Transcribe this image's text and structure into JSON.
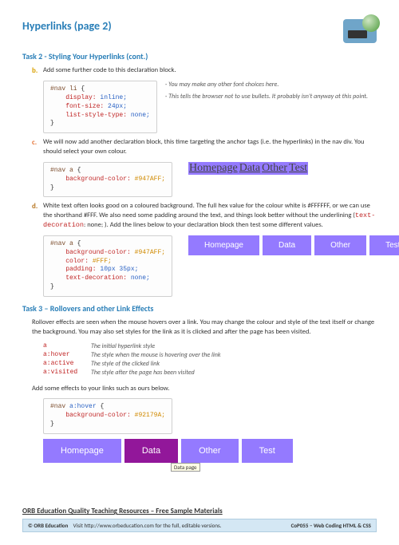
{
  "header": {
    "title": "Hyperlinks (page 2)"
  },
  "task2": {
    "heading": "Task 2 - Styling Your Hyperlinks (cont.)",
    "b": {
      "marker": "b.",
      "text": "Add some further code to this declaration block.",
      "code": {
        "sel": "#nav li",
        "l1p": "display:",
        "l1v": "inline;",
        "l2p": "font-size:",
        "l2v": "24px;",
        "l3p": "list-style-type:",
        "l3v": "none;"
      },
      "note1": "You may make any other font choices here.",
      "note2": "This tells the browser not to use bullets.  It probably isn't anyway at this point."
    },
    "c": {
      "marker": "c.",
      "text": "We will now add another declaration block, this time targeting the anchor tags (i.e. the hyperlinks) in the nav div.  You should select your own colour.",
      "code": {
        "sel": "#nav a",
        "l1p": "background-color:",
        "l1v": "#947AFF;"
      },
      "demo": [
        "Homepage",
        "Data",
        "Other",
        "Test"
      ]
    },
    "d": {
      "marker": "d.",
      "text_a": "White text often looks good on a coloured background.  The full hex value for the colour white is #FFFFFF, or we can use the shorthand #FFF.  We also need some padding around the text, and things look better without the underlining (",
      "kw": "text-decoration",
      "text_b": ": none; ).  Add the lines below to your declaration block then test some different values.",
      "code": {
        "sel": "#nav a",
        "l1p": "background-color:",
        "l1v": "#947AFF;",
        "l2p": "color:",
        "l2v": "#FFF;",
        "l3p": "padding:",
        "l3v": "10px 35px;",
        "l4p": "text-decoration:",
        "l4v": "none;"
      },
      "demo": [
        "Homepage",
        "Data",
        "Other",
        "Test"
      ]
    }
  },
  "task3": {
    "heading": "Task 3 – Rollovers and other Link Effects",
    "intro": "Rollover effects are seen when the mouse hovers over a link.  You may change the colour and style of the text itself or change the background.  You may also set styles for the link as it is clicked and after the page has been visited.",
    "rows": [
      {
        "k": "a",
        "v": "The initial hyperlink style"
      },
      {
        "k": "a:hover",
        "v": "The style when the mouse is hovering over the link"
      },
      {
        "k": "a:active",
        "v": "The style of the clicked link"
      },
      {
        "k": "a:visited",
        "v": "The style after the page has been visited"
      }
    ],
    "instruction": "Add some effects to your links such as ours below.",
    "code": {
      "sel1": "#nav ",
      "sel2": "a:hover",
      "l1p": "background-color:",
      "l1v": "#92179A;"
    },
    "demo": [
      "Homepage",
      "Data",
      "Other",
      "Test"
    ],
    "tooltip": "Data page"
  },
  "footer": {
    "title": "ORB Education Quality Teaching Resources – Free Sample Materials",
    "left_a": "© ORB Education",
    "left_b": "Visit http://www.orbeducation.com for the full, editable versions.",
    "right": "CoP055 – Web Coding HTML & CSS"
  }
}
